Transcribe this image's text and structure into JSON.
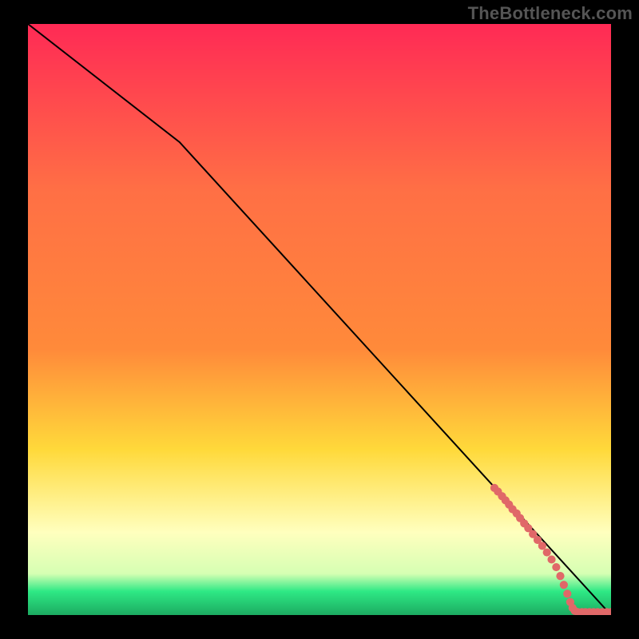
{
  "watermark": "TheBottleneck.com",
  "chart_data": {
    "type": "line",
    "title": "",
    "xlabel": "",
    "ylabel": "",
    "xlim": [
      0,
      100
    ],
    "ylim": [
      0,
      100
    ],
    "background_gradient": {
      "top": "#ff2a55",
      "mid_upper": "#ff8a3a",
      "mid": "#ffd93a",
      "mid_lower": "#ffffbe",
      "green_band": "#2ee985",
      "bottom": "#1cab61"
    },
    "curve": {
      "x": [
        0,
        26,
        100
      ],
      "y": [
        100,
        80,
        0
      ]
    },
    "points": [
      {
        "x": 80.0,
        "y": 21.5
      },
      {
        "x": 80.6,
        "y": 20.9
      },
      {
        "x": 81.3,
        "y": 20.1
      },
      {
        "x": 81.9,
        "y": 19.4
      },
      {
        "x": 82.5,
        "y": 18.7
      },
      {
        "x": 83.1,
        "y": 17.9
      },
      {
        "x": 83.8,
        "y": 17.2
      },
      {
        "x": 84.4,
        "y": 16.4
      },
      {
        "x": 85.1,
        "y": 15.5
      },
      {
        "x": 85.8,
        "y": 14.7
      },
      {
        "x": 86.6,
        "y": 13.7
      },
      {
        "x": 87.4,
        "y": 12.7
      },
      {
        "x": 88.2,
        "y": 11.7
      },
      {
        "x": 89.0,
        "y": 10.6
      },
      {
        "x": 89.8,
        "y": 9.4
      },
      {
        "x": 90.6,
        "y": 8.1
      },
      {
        "x": 91.3,
        "y": 6.6
      },
      {
        "x": 91.9,
        "y": 5.1
      },
      {
        "x": 92.5,
        "y": 3.6
      },
      {
        "x": 93.0,
        "y": 2.2
      },
      {
        "x": 93.4,
        "y": 1.2
      },
      {
        "x": 93.8,
        "y": 0.7
      },
      {
        "x": 94.3,
        "y": 0.5
      },
      {
        "x": 95.0,
        "y": 0.5
      },
      {
        "x": 95.6,
        "y": 0.5
      },
      {
        "x": 96.3,
        "y": 0.5
      },
      {
        "x": 97.0,
        "y": 0.5
      },
      {
        "x": 97.7,
        "y": 0.5
      },
      {
        "x": 98.5,
        "y": 0.5
      },
      {
        "x": 99.3,
        "y": 0.5
      },
      {
        "x": 100.0,
        "y": 0.5
      }
    ],
    "point_style": {
      "fill": "#e06868",
      "radius_frac": 0.007
    }
  }
}
